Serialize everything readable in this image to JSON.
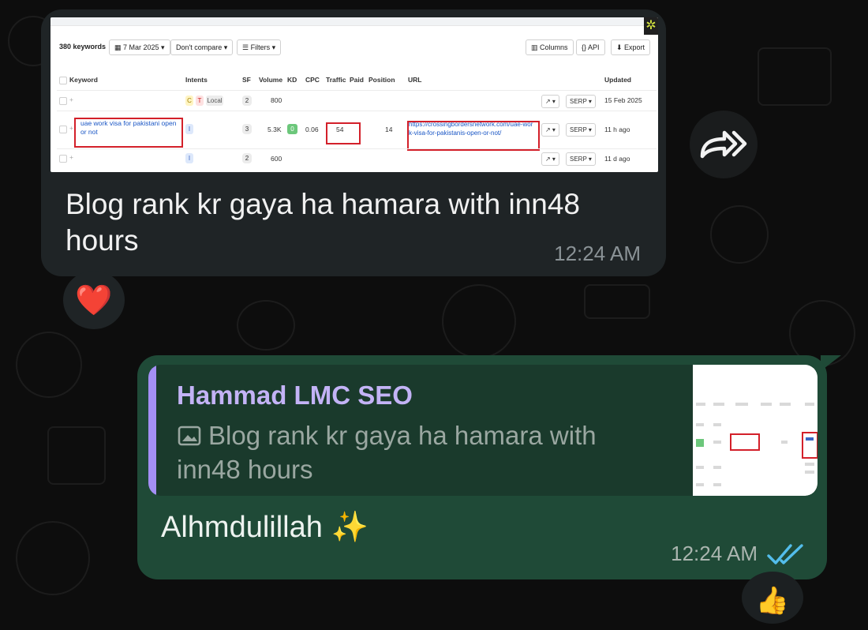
{
  "incoming": {
    "screenshot": {
      "keyword_count": "380 keywords",
      "date_filter": "7 Mar 2025",
      "compare": "Don't compare",
      "filters": "Filters",
      "columns_btn": "Columns",
      "api_btn": "API",
      "export_btn": "Export",
      "headers": [
        "Keyword",
        "Intents",
        "SF",
        "Volume",
        "KD",
        "CPC",
        "Traffic",
        "Paid",
        "Position",
        "URL",
        "Updated"
      ],
      "rows": [
        {
          "keyword": "",
          "intents": [
            "C",
            "T",
            "Local"
          ],
          "sf": "2",
          "volume": "800",
          "kd": "",
          "cpc": "",
          "traffic": "",
          "position": "",
          "url": "",
          "serp": "SERP",
          "updated": "15 Feb 2025"
        },
        {
          "keyword": "uae work visa for pakistani open or not",
          "intents": [
            "I"
          ],
          "sf": "3",
          "volume": "5.3K",
          "kd": "0",
          "cpc": "0.06",
          "traffic": "54",
          "position": "14",
          "url": "https://crossingbordersnetwork.com/uae-work-visa-for-pakistanis-open-or-not/",
          "serp": "SERP",
          "updated": "11 h ago"
        },
        {
          "keyword": "",
          "intents": [
            "I"
          ],
          "sf": "2",
          "volume": "600",
          "kd": "",
          "cpc": "",
          "traffic": "",
          "position": "",
          "url": "",
          "serp": "SERP",
          "updated": "11 d ago"
        }
      ]
    },
    "caption": "Blog rank kr gaya ha hamara with inn48 hours",
    "time": "12:24 AM",
    "reaction": "❤️"
  },
  "outgoing": {
    "quote_author": "Hammad LMC SEO",
    "quote_text": "Blog rank kr gaya ha hamara with inn48 hours",
    "message": "Alhmdulillah ✨",
    "time": "12:24 AM",
    "reaction": "👍"
  },
  "icons": [
    "forward-icon",
    "image-icon",
    "read-ticks-icon",
    "trend-icon"
  ],
  "colors": {
    "incoming_bubble": "#1f2426",
    "outgoing_bubble": "#1f4a37",
    "quote_accent": "#a48ff5",
    "read_ticks": "#53bdeb",
    "highlight_box": "#d3202a"
  }
}
